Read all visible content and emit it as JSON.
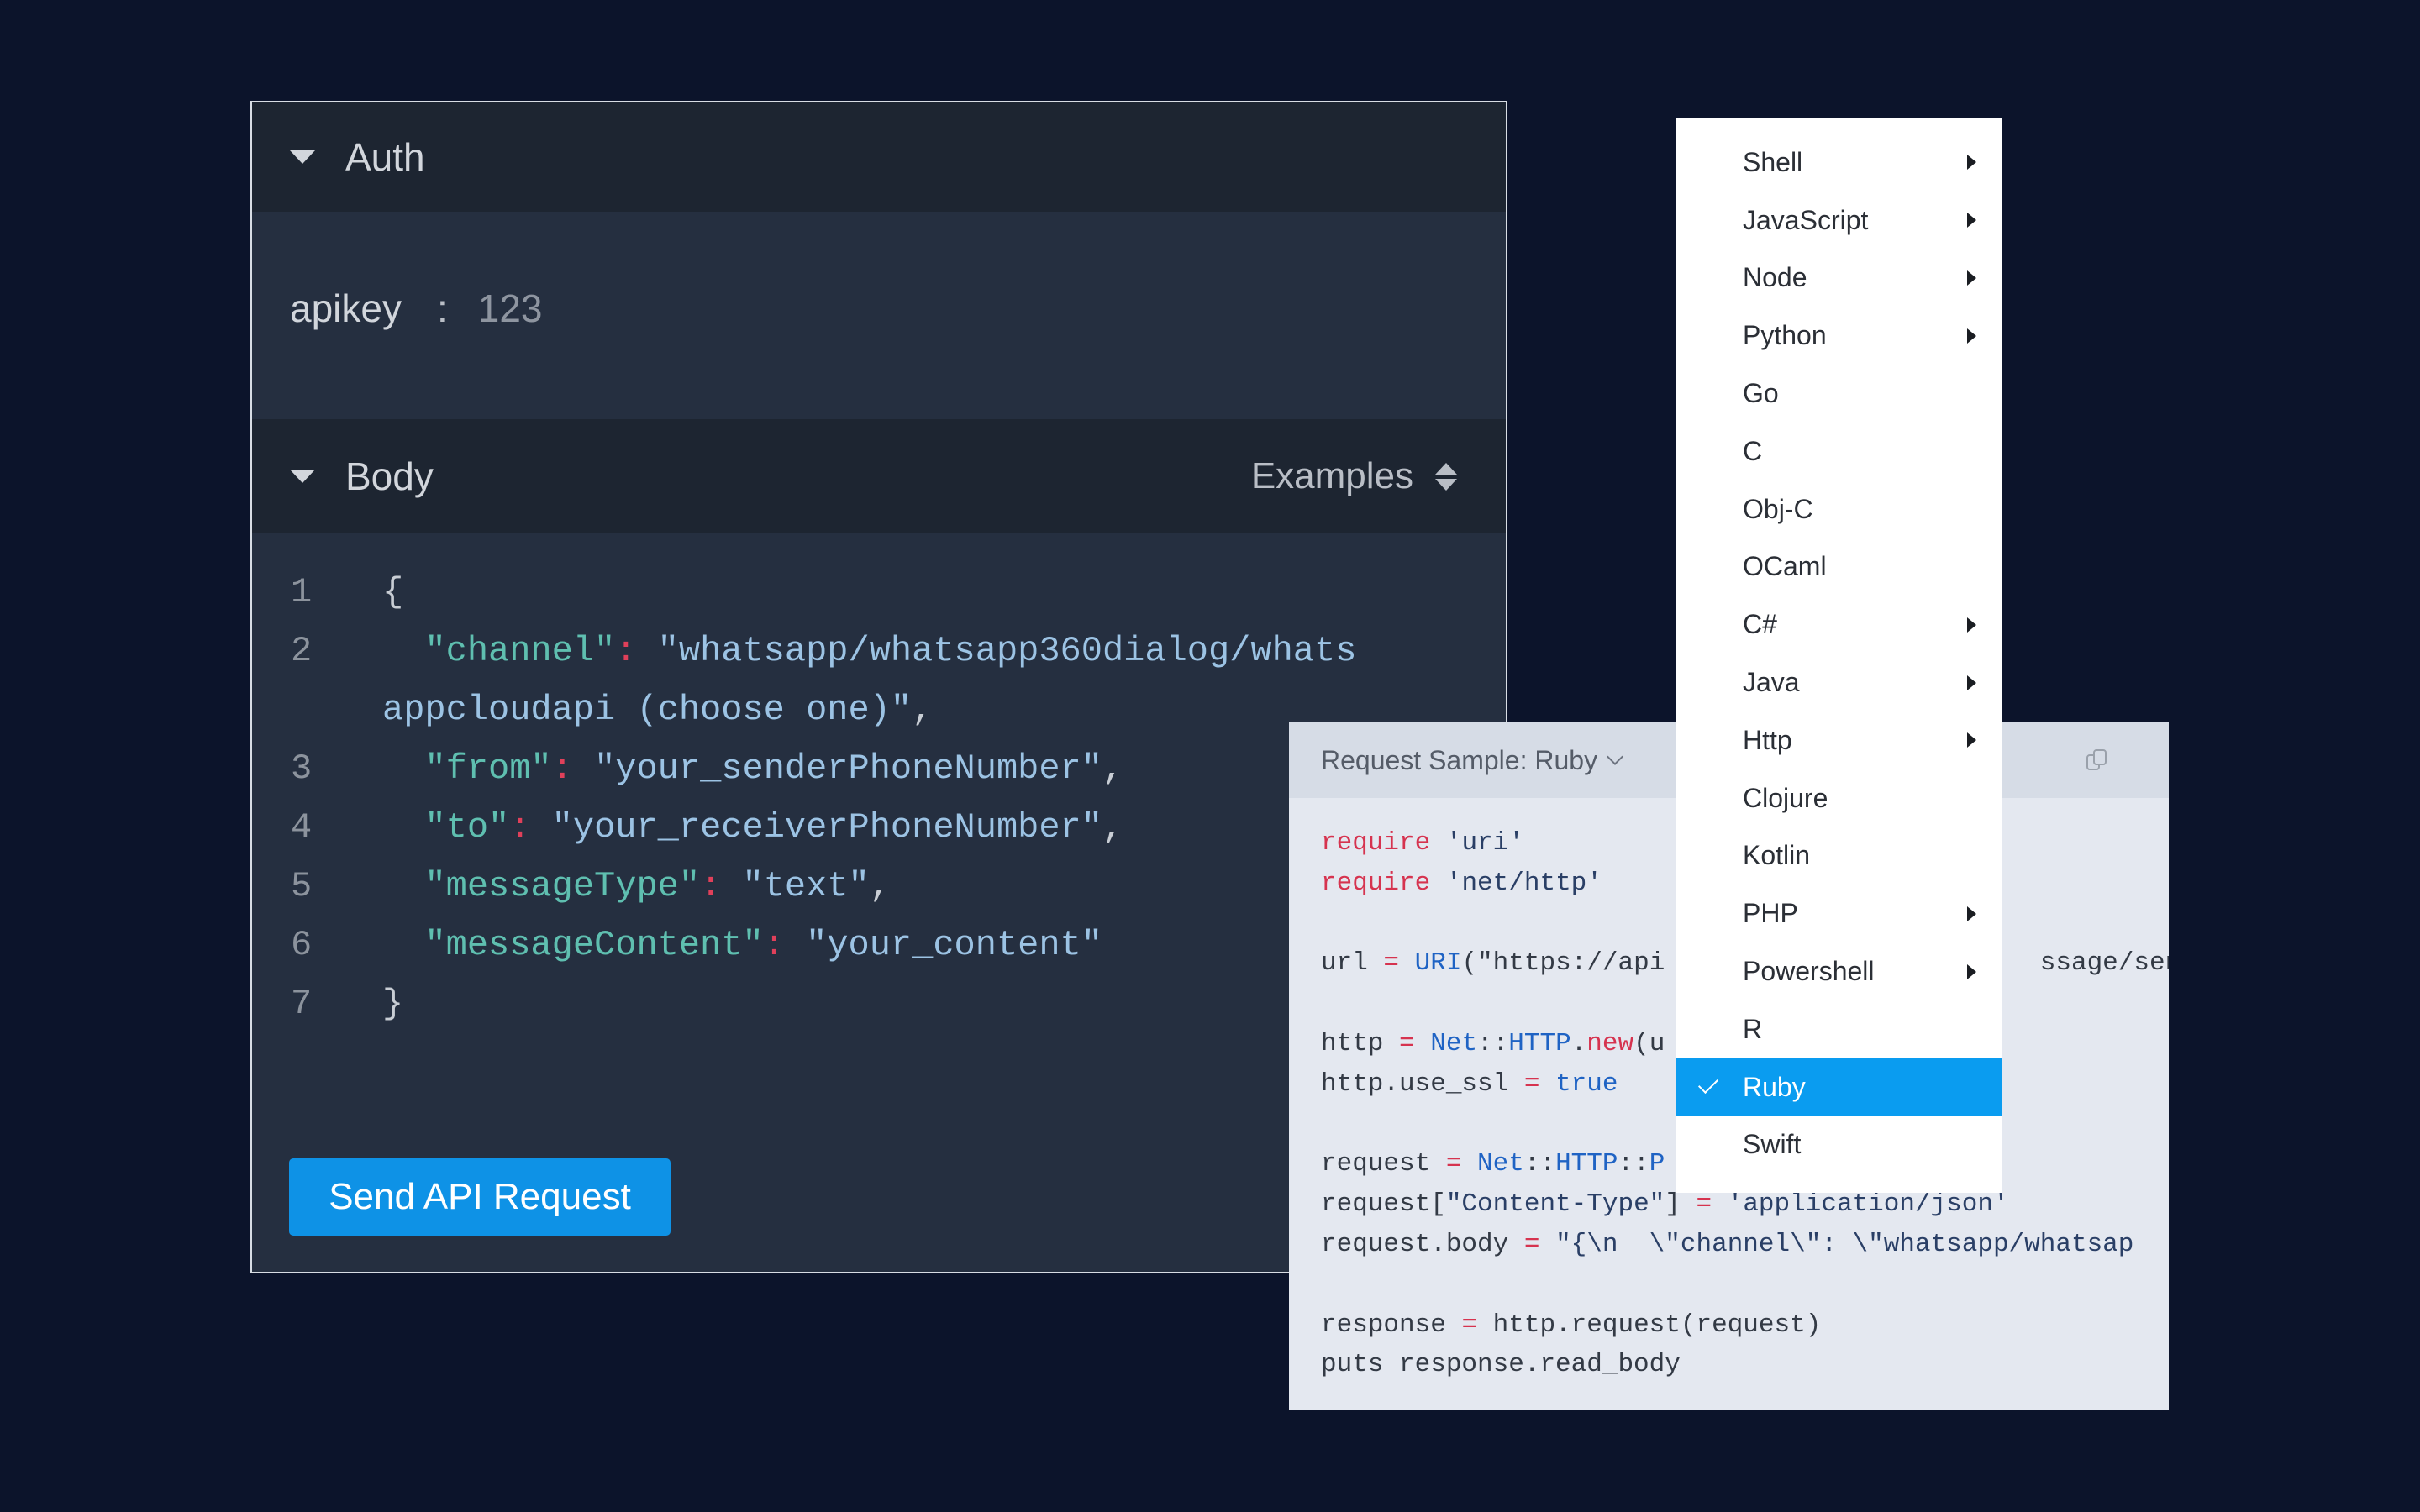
{
  "left_panel": {
    "auth": {
      "title": "Auth",
      "key": "apikey",
      "separator": ":",
      "value": "123"
    },
    "body": {
      "title": "Body",
      "examples_label": "Examples"
    },
    "code_lines": [
      {
        "num": "1",
        "parts": [
          [
            "t",
            "{"
          ]
        ]
      },
      {
        "num": "2",
        "parts": [
          [
            "k",
            "  \"channel\""
          ],
          [
            "p",
            ": "
          ],
          [
            "s",
            "\"whatsapp/whatsapp360dialog/whats"
          ]
        ]
      },
      {
        "num": "",
        "parts": [
          [
            "s",
            "appcloudapi (choose one)\""
          ],
          [
            "t",
            ","
          ]
        ]
      },
      {
        "num": "3",
        "parts": [
          [
            "k",
            "  \"from\""
          ],
          [
            "p",
            ": "
          ],
          [
            "s",
            "\"your_senderPhoneNumber\""
          ],
          [
            "t",
            ","
          ]
        ]
      },
      {
        "num": "4",
        "parts": [
          [
            "k",
            "  \"to\""
          ],
          [
            "p",
            ": "
          ],
          [
            "s",
            "\"your_receiverPhoneNumber\""
          ],
          [
            "t",
            ","
          ]
        ]
      },
      {
        "num": "5",
        "parts": [
          [
            "k",
            "  \"messageType\""
          ],
          [
            "p",
            ": "
          ],
          [
            "s",
            "\"text\""
          ],
          [
            "t",
            ","
          ]
        ]
      },
      {
        "num": "6",
        "parts": [
          [
            "k",
            "  \"messageContent\""
          ],
          [
            "p",
            ": "
          ],
          [
            "s",
            "\"your_content\""
          ]
        ]
      },
      {
        "num": "7",
        "parts": [
          [
            "t",
            "}"
          ]
        ]
      }
    ],
    "send_button": "Send API Request"
  },
  "sample_panel": {
    "title": "Request Sample: Ruby",
    "copy_icon": "copy-icon",
    "lines": [
      [
        [
          "rk",
          "require"
        ],
        [
          "rd",
          " "
        ],
        [
          "rs",
          "'uri'"
        ]
      ],
      [
        [
          "rk",
          "require"
        ],
        [
          "rd",
          " "
        ],
        [
          "rs",
          "'net/http'"
        ]
      ],
      [],
      [
        [
          "rd",
          "url "
        ],
        [
          "rk",
          "="
        ],
        [
          "rd",
          " "
        ],
        [
          "rb",
          "URI"
        ],
        [
          "rd",
          "(\"https://api"
        ],
        [
          "rd",
          "                        ssage/send"
        ]
      ],
      [],
      [
        [
          "rd",
          "http "
        ],
        [
          "rk",
          "="
        ],
        [
          "rd",
          " "
        ],
        [
          "rb",
          "Net"
        ],
        [
          "rd",
          "::"
        ],
        [
          "rb",
          "HTTP"
        ],
        [
          "rd",
          "."
        ],
        [
          "rk",
          "new"
        ],
        [
          "rd",
          "(u"
        ]
      ],
      [
        [
          "rd",
          "http.use_ssl "
        ],
        [
          "rk",
          "="
        ],
        [
          "rd",
          " "
        ],
        [
          "rb",
          "true"
        ]
      ],
      [],
      [
        [
          "rd",
          "request "
        ],
        [
          "rk",
          "="
        ],
        [
          "rd",
          " "
        ],
        [
          "rb",
          "Net"
        ],
        [
          "rd",
          "::"
        ],
        [
          "rb",
          "HTTP"
        ],
        [
          "rd",
          "::"
        ],
        [
          "rb",
          "P"
        ]
      ],
      [
        [
          "rd",
          "request["
        ],
        [
          "rs",
          "\"Content-Type\""
        ],
        [
          "rd",
          "] "
        ],
        [
          "rk",
          "="
        ],
        [
          "rd",
          " "
        ],
        [
          "rs",
          "'application/json'"
        ]
      ],
      [
        [
          "rd",
          "request.body "
        ],
        [
          "rk",
          "="
        ],
        [
          "rd",
          " "
        ],
        [
          "rs",
          "\"{\\n  \\\"channel\\\": \\\"whatsapp/whatsap"
        ]
      ],
      [],
      [
        [
          "rd",
          "response "
        ],
        [
          "rk",
          "="
        ],
        [
          "rd",
          " http.request(request)"
        ]
      ],
      [
        [
          "rd",
          "puts response.read_body"
        ]
      ]
    ]
  },
  "language_menu": {
    "selected": "Ruby",
    "items": [
      {
        "label": "Shell",
        "submenu": true
      },
      {
        "label": "JavaScript",
        "submenu": true
      },
      {
        "label": "Node",
        "submenu": true
      },
      {
        "label": "Python",
        "submenu": true
      },
      {
        "label": "Go",
        "submenu": false
      },
      {
        "label": "C",
        "submenu": false
      },
      {
        "label": "Obj-C",
        "submenu": false
      },
      {
        "label": "OCaml",
        "submenu": false
      },
      {
        "label": "C#",
        "submenu": true
      },
      {
        "label": "Java",
        "submenu": true
      },
      {
        "label": "Http",
        "submenu": true
      },
      {
        "label": "Clojure",
        "submenu": false
      },
      {
        "label": "Kotlin",
        "submenu": false
      },
      {
        "label": "PHP",
        "submenu": true
      },
      {
        "label": "Powershell",
        "submenu": true
      },
      {
        "label": "R",
        "submenu": false
      },
      {
        "label": "Ruby",
        "submenu": false
      },
      {
        "label": "Swift",
        "submenu": false
      }
    ]
  },
  "colors": {
    "background": "#0c142b",
    "accent": "#0e92e6",
    "menu_selected": "#0a9cf0"
  }
}
